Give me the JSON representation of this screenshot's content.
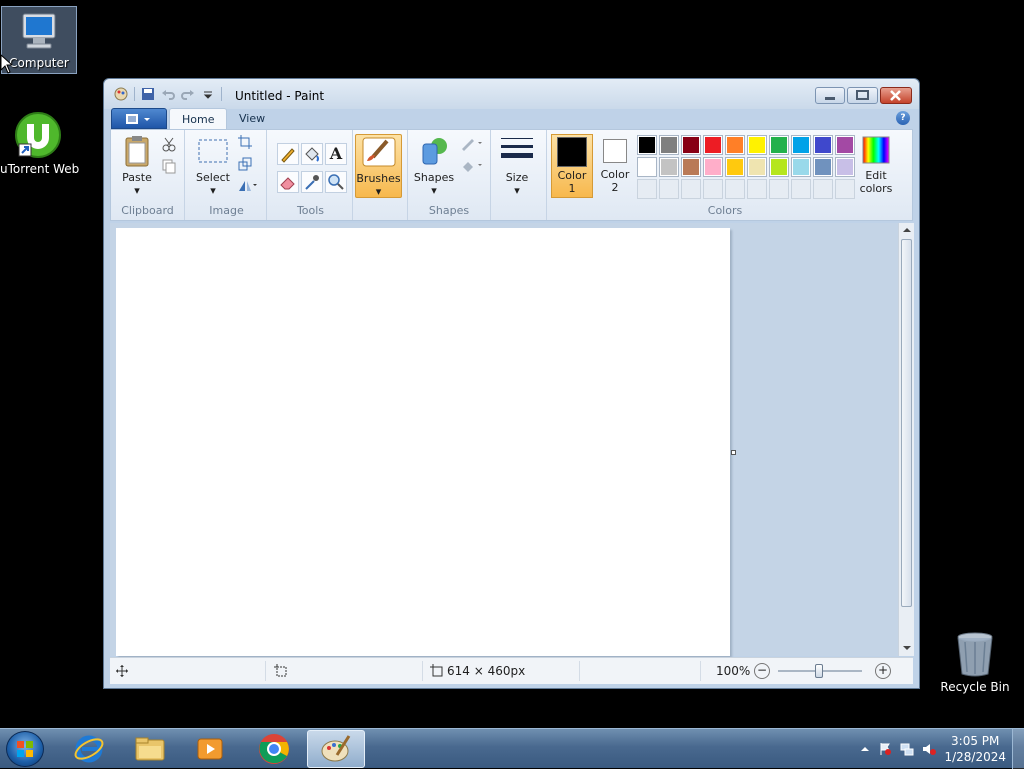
{
  "desktop": {
    "icons": [
      {
        "label": "Computer"
      },
      {
        "label": "uTorrent Web"
      },
      {
        "label": "Recycle Bin"
      }
    ]
  },
  "window": {
    "title": "Untitled - Paint",
    "tabs": [
      "Home",
      "View"
    ],
    "ribbon": {
      "clipboard": {
        "paste": "Paste",
        "label": "Clipboard"
      },
      "image": {
        "select": "Select",
        "label": "Image"
      },
      "tools": {
        "label": "Tools",
        "text_tool": "A"
      },
      "brushes": "Brushes",
      "shapes": {
        "shapes": "Shapes",
        "label": "Shapes"
      },
      "size": "Size",
      "colors": {
        "color1": "Color",
        "color1_num": "1",
        "color2": "Color",
        "color2_num": "2",
        "edit_line1": "Edit",
        "edit_line2": "colors",
        "label": "Colors",
        "color1_value": "#000000",
        "color2_value": "#ffffff",
        "palette_row1": [
          "#000000",
          "#7f7f7f",
          "#880015",
          "#ed1c24",
          "#ff7f27",
          "#fff200",
          "#22b14c",
          "#00a2e8",
          "#3f48cc",
          "#a349a4"
        ],
        "palette_row2": [
          "#ffffff",
          "#c3c3c3",
          "#b97a57",
          "#ffaec9",
          "#ffc90e",
          "#efe4b0",
          "#b5e61d",
          "#99d9ea",
          "#7092be",
          "#c8bfe7"
        ]
      }
    },
    "status": {
      "dimensions": "614 × 460px",
      "zoom": "100%",
      "zoom_minus": "−",
      "zoom_plus": "+"
    }
  },
  "taskbar": {
    "time": "3:05 PM",
    "date": "1/28/2024",
    "apps": [
      "internet-explorer-icon",
      "file-explorer-icon",
      "media-player-icon",
      "chrome-icon",
      "paint-icon"
    ]
  }
}
